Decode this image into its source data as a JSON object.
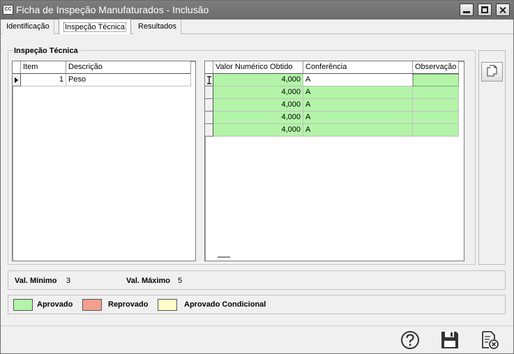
{
  "window": {
    "title": "Ficha de Inspeção Manufaturados - Inclusão",
    "icon_text": "CC"
  },
  "tabs": [
    {
      "label": "Identificação",
      "active": false
    },
    {
      "label": "Inspeção Técnica",
      "active": true
    },
    {
      "label": "Resultados",
      "active": false
    }
  ],
  "group": {
    "title": "Inspeção Técnica"
  },
  "items_grid": {
    "headers": [
      "Item",
      "Descrição"
    ],
    "rows": [
      {
        "item": "1",
        "descricao": "Peso"
      }
    ]
  },
  "results_grid": {
    "headers": [
      "Valor Numérico Obtido",
      "Conferência",
      "Observação"
    ],
    "rows": [
      {
        "valor": "4,000",
        "conferencia": "A",
        "observacao": ""
      },
      {
        "valor": "4,000",
        "conferencia": "A",
        "observacao": ""
      },
      {
        "valor": "4,000",
        "conferencia": "A",
        "observacao": ""
      },
      {
        "valor": "4,000",
        "conferencia": "A",
        "observacao": ""
      },
      {
        "valor": "4,000",
        "conferencia": "A",
        "observacao": ""
      }
    ],
    "row_color": "#b3f4a8"
  },
  "limits": {
    "min_label": "Val. Mínimo",
    "min_value": "3",
    "max_label": "Val. Máximo",
    "max_value": "5"
  },
  "legend": [
    {
      "label": "Aprovado",
      "color": "#b3f4a8"
    },
    {
      "label": "Reprovado",
      "color": "#f4a090"
    },
    {
      "label": "Aprovado Condicional",
      "color": "#ffffc8"
    }
  ],
  "icons": {
    "minimize": "minimize-icon",
    "maximize": "maximize-icon",
    "close": "close-icon",
    "copy": "copy-document-icon",
    "help": "help-icon",
    "save": "floppy-disk-icon",
    "cancel": "cancel-document-icon"
  }
}
